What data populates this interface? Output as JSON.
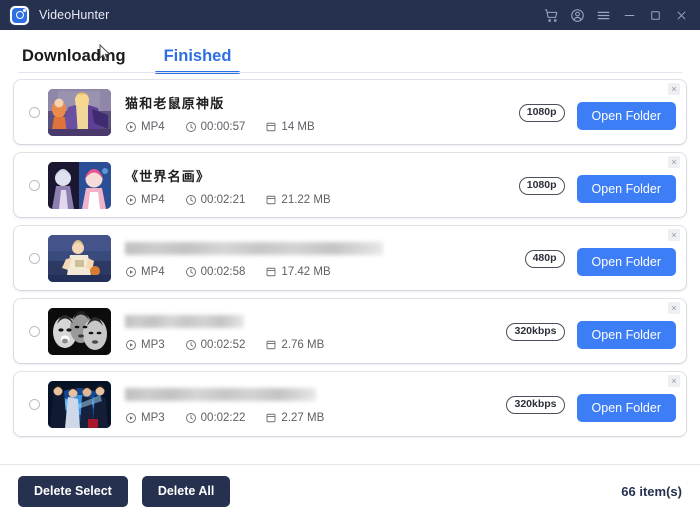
{
  "window": {
    "app_title": "VideoHunter",
    "logo_icon": "videohunter-logo-icon",
    "controls": [
      {
        "name": "cart-icon",
        "label": "cart"
      },
      {
        "name": "account-icon",
        "label": "account"
      },
      {
        "name": "menu-icon",
        "label": "menu"
      },
      {
        "name": "minimize-icon",
        "label": "minimize"
      },
      {
        "name": "maximize-icon",
        "label": "maximize"
      },
      {
        "name": "close-icon",
        "label": "close"
      }
    ],
    "titlebar_color": "#26304f"
  },
  "tabs": {
    "items": [
      {
        "label": "Downloading",
        "active": false
      },
      {
        "label": "Finished",
        "active": true
      }
    ],
    "active_color": "#2f6fe4"
  },
  "list": {
    "rows": [
      {
        "title": "猫和老鼠原神版",
        "redacted": false,
        "format": "MP4",
        "duration": "00:00:57",
        "size": "14 MB",
        "badge": "1080p",
        "action_label": "Open Folder",
        "selected": false
      },
      {
        "title": "《世界名画》",
        "redacted": false,
        "format": "MP4",
        "duration": "00:02:21",
        "size": "21.22 MB",
        "badge": "1080p",
        "action_label": "Open Folder",
        "selected": false
      },
      {
        "title": "",
        "redacted": true,
        "redacted_width": 258,
        "format": "MP4",
        "duration": "00:02:58",
        "size": "17.42 MB",
        "badge": "480p",
        "action_label": "Open Folder",
        "selected": false
      },
      {
        "title": "",
        "redacted": true,
        "redacted_width": 119,
        "format": "MP3",
        "duration": "00:02:52",
        "size": "2.76 MB",
        "badge": "320kbps",
        "action_label": "Open Folder",
        "selected": false
      },
      {
        "title": "",
        "redacted": true,
        "redacted_width": 191,
        "format": "MP3",
        "duration": "00:02:22",
        "size": "2.27 MB",
        "badge": "320kbps",
        "action_label": "Open Folder",
        "selected": false
      }
    ],
    "remove_icon": "×",
    "format_icon": "play-circle-icon",
    "duration_icon": "clock-icon",
    "size_icon": "file-icon",
    "action_color": "#3d7ef7"
  },
  "footer": {
    "delete_select_label": "Delete Select",
    "delete_all_label": "Delete All",
    "count_label": "66 item(s)",
    "button_color": "#26304f"
  }
}
